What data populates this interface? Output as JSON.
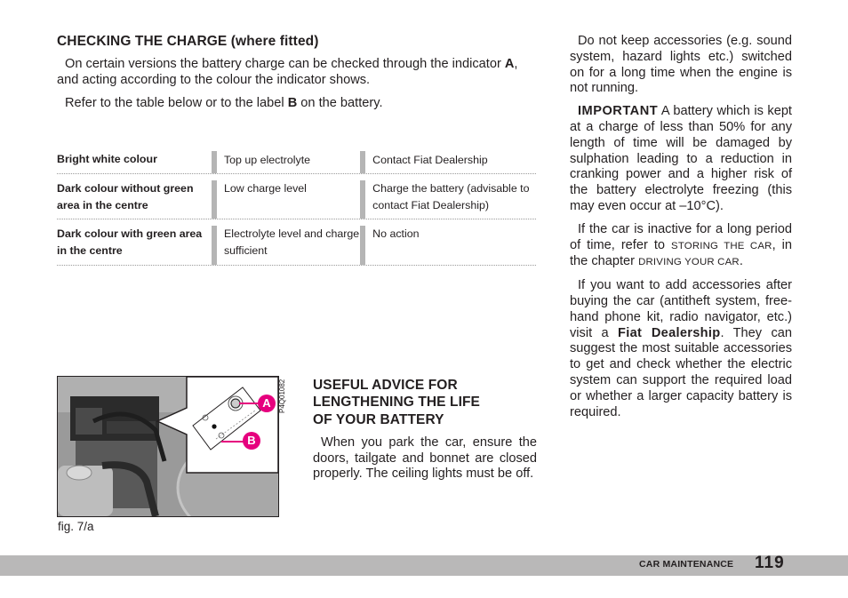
{
  "left_column": {
    "section_title": "CHECKING THE CHARGE",
    "section_title_suffix": "(where fitted)",
    "para1_before": "On certain versions the battery charge can be checked through the indicator ",
    "para1_bold": "A",
    "para1_after": ", and acting according to the colour the indicator shows.",
    "para2_before": "Refer to the table below or to the label ",
    "para2_bold": "B",
    "para2_after": " on the battery."
  },
  "charge_table": {
    "rows": [
      {
        "colour": "Bright white colour",
        "meaning": "Top up electrolyte",
        "action": "Contact Fiat Dealership"
      },
      {
        "colour": "Dark colour without green area in the centre",
        "meaning": "Low charge level",
        "action": "Charge the battery (advisable to contact Fiat Dealership)"
      },
      {
        "colour": "Dark colour with green area in the centre",
        "meaning": "Electrolyte level and charge sufficient",
        "action": "No action"
      }
    ]
  },
  "figure": {
    "caption": "fig. 7/a",
    "code": "P4Q01082",
    "callout_a": "A",
    "callout_b": "B",
    "callout_color": "#e6007e"
  },
  "middle_column": {
    "title_line1": "USEFUL ADVICE FOR",
    "title_line2": "LENGTHENING THE LIFE",
    "title_line3": "OF YOUR BATTERY",
    "para": "When you park the car, ensure the doors, tailgate and bonnet are closed properly. The ceiling lights must be off."
  },
  "right_column": {
    "para1": "Do not keep accessories (e.g. sound system, hazard lights etc.) switched on for a long time when the engine is not running.",
    "para2_bold": "IMPORTANT",
    "para2_rest": " A battery which is kept at a charge of less than 50% for any length of time will be damaged by sulphation leading to a reduction in cranking power and a higher risk of the battery electrolyte freezing (this may even occur at –10°C).",
    "para3_before": "If the car is inactive for a long period of time, refer to ",
    "para3_sc1": "STORING THE CAR",
    "para3_mid": ", in the chapter ",
    "para3_sc2": "DRIVING YOUR CAR",
    "para3_after": ".",
    "para4_before": "If you want to add accessories after buying the car (antitheft system, free-hand phone kit, radio navigator, etc.) visit a ",
    "para4_bold": "Fiat Dealership",
    "para4_after": ". They can suggest the most suitable accessories to get and check whether the electric system can support the required load or whether a larger capacity battery is required."
  },
  "footer": {
    "section": "CAR MAINTENANCE",
    "page_number": "119"
  }
}
